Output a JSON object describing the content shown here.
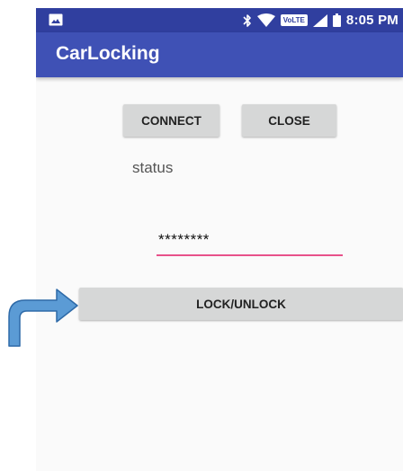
{
  "status_bar": {
    "time": "8:05 PM",
    "volte_label": "VoLTE",
    "icons": [
      "image-notification-icon",
      "bluetooth-icon",
      "wifi-icon",
      "signal-icon",
      "battery-icon"
    ]
  },
  "app": {
    "title": "CarLocking"
  },
  "buttons": {
    "connect_label": "CONNECT",
    "close_label": "CLOSE",
    "lock_unlock_label": "LOCK/UNLOCK"
  },
  "status_label": "status",
  "password_field": {
    "value": "********"
  },
  "colors": {
    "status_bar": "#303f9f",
    "app_bar": "#3f51b5",
    "field_accent": "#e8518a",
    "arrow": "#5b9bd5"
  }
}
